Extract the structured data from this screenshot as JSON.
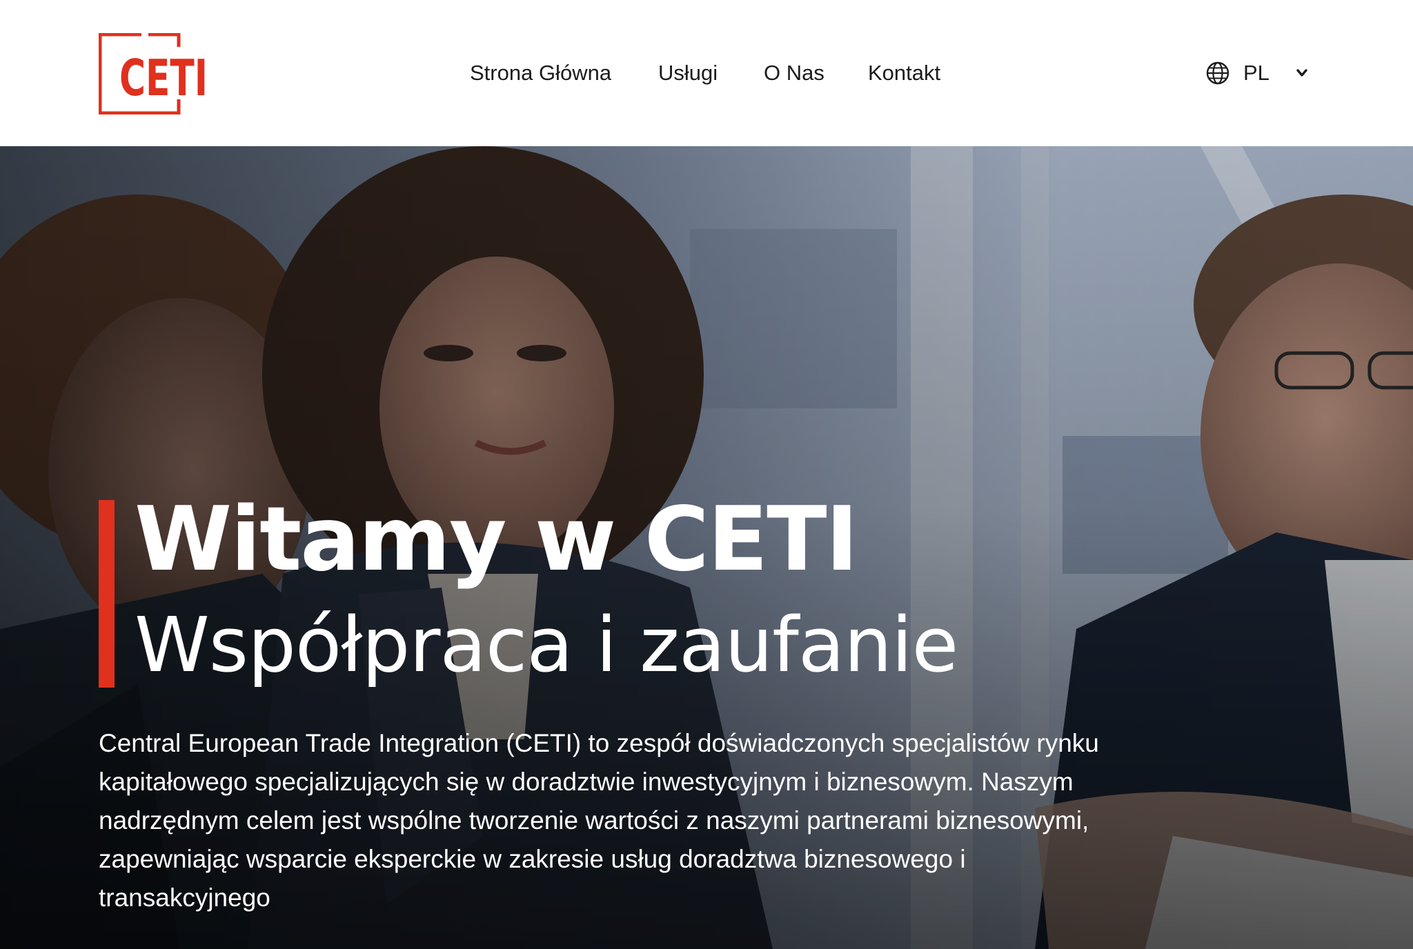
{
  "brand": {
    "logo_text": "CETI",
    "accent_color": "#e0301e"
  },
  "nav": {
    "items": [
      {
        "label": "Strona Główna"
      },
      {
        "label": "Usługi"
      },
      {
        "label": "O Nas"
      },
      {
        "label": "Kontakt"
      }
    ]
  },
  "language": {
    "icon": "globe-icon",
    "selected": "PL",
    "dropdown_icon": "chevron-down-icon"
  },
  "hero": {
    "title": "Witamy w CETI",
    "subtitle": "Współpraca i zaufanie",
    "text": "Central European Trade Integration (CETI) to zespół doświadczonych specjalistów rynku kapitałowego specjalizujących się w doradztwie inwestycyjnym i biznesowym. Naszym nadrzędnym celem jest wspólne tworzenie wartości z naszymi partnerami biznesowymi, zapewniając wsparcie eksperckie w zakresie usług doradztwa biznesowego i transakcyjnego"
  }
}
